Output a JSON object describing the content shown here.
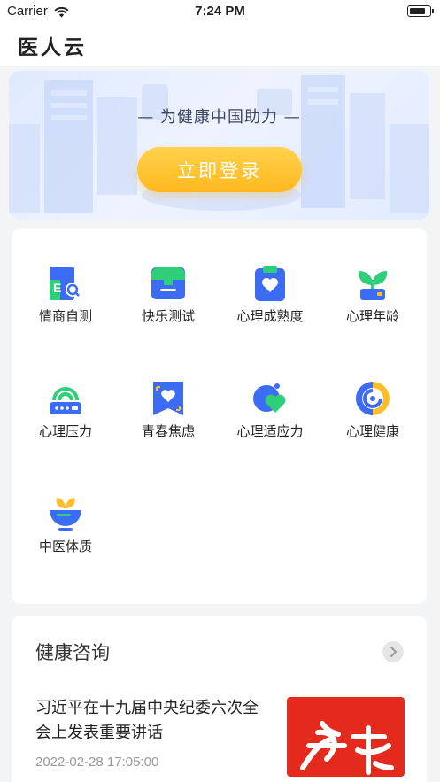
{
  "status_bar": {
    "carrier": "Carrier",
    "time": "7:24 PM"
  },
  "app": {
    "title": "医人云"
  },
  "banner": {
    "slogan": "— 为健康中国助力 —",
    "login_label": "立即登录"
  },
  "tools": [
    {
      "label": "情商自测",
      "icon": "eq-test-icon"
    },
    {
      "label": "快乐测试",
      "icon": "inbox-tray-icon"
    },
    {
      "label": "心理成熟度",
      "icon": "heart-clipboard-icon"
    },
    {
      "label": "心理年龄",
      "icon": "sprout-icon"
    },
    {
      "label": "心理压力",
      "icon": "signal-router-icon"
    },
    {
      "label": "青春焦虑",
      "icon": "heart-bookmark-icon"
    },
    {
      "label": "心理适应力",
      "icon": "heart-bubble-icon"
    },
    {
      "label": "心理健康",
      "icon": "target-ring-icon"
    },
    {
      "label": "中医体质",
      "icon": "herb-bowl-icon"
    }
  ],
  "news": {
    "heading": "健康咨询",
    "item": {
      "title": "习近平在十九届中央纪委六次全会上发表重要讲话",
      "time": "2022-02-28 17:05:00"
    }
  },
  "colors": {
    "accent_blue": "#3d6cf4",
    "accent_green": "#2fcf7a",
    "accent_yellow": "#ffbe28",
    "news_red": "#e42a1c"
  }
}
